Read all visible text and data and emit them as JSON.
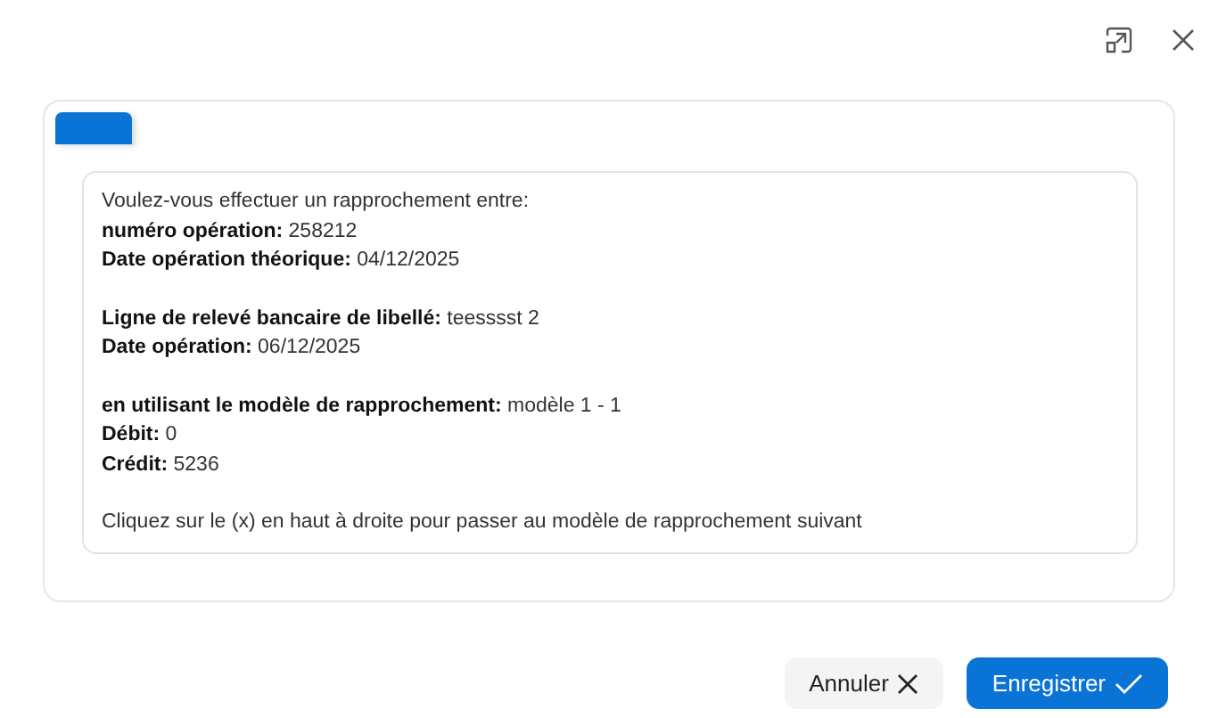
{
  "message": {
    "groups": [
      [
        "Voulez-vous effectuer un rapprochement entre:",
        "**numéro opération:** 258212",
        "**Date opération théorique:** 04/12/2025"
      ],
      [
        "**Ligne de relevé bancaire de libellé:** teesssst 2",
        "**Date opération:** 06/12/2025"
      ],
      [
        "**en utilisant le modèle de rapprochement:** modèle 1 - 1",
        "**Débit:** 0",
        "**Crédit:** 5236"
      ],
      [
        "Cliquez sur le (x) en haut à droite pour passer au modèle de rapprochement suivant"
      ]
    ]
  },
  "buttons": [
    {
      "label": "Annuler",
      "kind": "cancel"
    },
    {
      "label": "Enregistrer",
      "kind": "save"
    }
  ]
}
